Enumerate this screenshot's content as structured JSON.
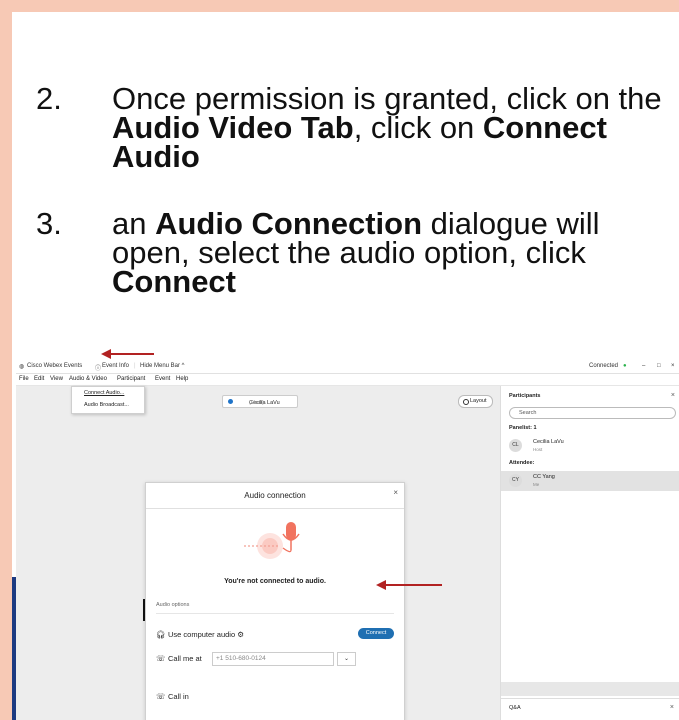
{
  "steps": [
    {
      "number": "2.",
      "parts": {
        "t1": "Once permission is granted, click on the ",
        "b1": "Audio Video Tab",
        "t2": ", click on ",
        "b2": "Connect Audio"
      }
    },
    {
      "number": "3.",
      "parts": {
        "t1": "an ",
        "b1": "Audio Connection",
        "t2": " dialogue will open, select the audio option, click ",
        "b2": "Connect"
      }
    }
  ],
  "app": {
    "titlebar": {
      "app_name": "Cisco Webex Events",
      "event_info": "Event Info",
      "hide_menu": "Hide Menu Bar ^",
      "status": "Connected",
      "window_controls": [
        "–",
        "□",
        "×"
      ]
    },
    "menu": [
      "File",
      "Edit",
      "View",
      "Audio & Video",
      "Participant",
      "Event",
      "Help"
    ],
    "audio_menu": [
      "Connect Audio...",
      "Audio Broadcast..."
    ],
    "host_pill": {
      "name": "Cecilia LaVu",
      "role": "(Host)"
    },
    "layout_label": "Layout",
    "participants": {
      "title": "Participants",
      "search_placeholder": "Search",
      "panelist_label": "Panelist: 1",
      "panelist": {
        "initials": "CL",
        "name": "Cecilia LaVu",
        "sub": "Host"
      },
      "attendee_label": "Attendee:",
      "attendee": {
        "initials": "CY",
        "name": "CC Yang",
        "sub": "Me"
      },
      "qa_label": "Q&A"
    },
    "dialog": {
      "title": "Audio connection",
      "status": "You're not connected to audio.",
      "options_label": "Audio options",
      "computer_audio": "Use computer audio",
      "connect_label": "Connect",
      "call_me_label": "Call me at",
      "call_me_value": "+1 510-680-0124",
      "call_in": "Call in"
    }
  },
  "colors": {
    "frame": "#f7c9b5",
    "band": "#2a4fa3",
    "arrow": "#b22222",
    "accent": "#1f6fb2"
  },
  "icons": [
    "webex-logo-icon",
    "info-icon",
    "headset-icon",
    "phone-icon",
    "microphone-icon",
    "search-icon",
    "close-icon"
  ]
}
